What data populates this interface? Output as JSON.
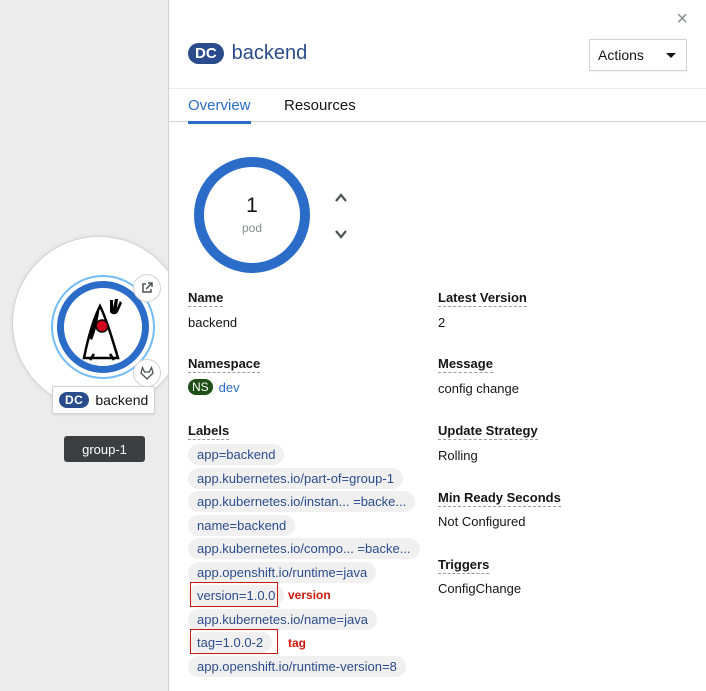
{
  "topology": {
    "node": {
      "kind_badge": "DC",
      "name": "backend"
    },
    "group_label": "group-1"
  },
  "panel": {
    "close_glyph": "×",
    "kind_badge": "DC",
    "title": "backend",
    "actions_label": "Actions",
    "tabs": [
      {
        "label": "Overview",
        "active": true
      },
      {
        "label": "Resources",
        "active": false
      }
    ],
    "pod_count": "1",
    "pod_unit": "pod",
    "left_fields": {
      "name": {
        "label": "Name",
        "value": "backend"
      },
      "namespace": {
        "label": "Namespace",
        "badge": "NS",
        "value": "dev"
      },
      "labels": {
        "label": "Labels"
      }
    },
    "right_fields": {
      "latest_version": {
        "label": "Latest Version",
        "value": "2"
      },
      "message": {
        "label": "Message",
        "value": "config change"
      },
      "update_strategy": {
        "label": "Update Strategy",
        "value": "Rolling"
      },
      "min_ready": {
        "label": "Min Ready Seconds",
        "value": "Not Configured"
      },
      "triggers": {
        "label": "Triggers",
        "value": "ConfigChange"
      }
    },
    "labels": [
      "app=backend",
      "app.kubernetes.io/part-of=group-1",
      "app.kubernetes.io/instan... =backe...",
      "name=backend",
      "app.kubernetes.io/compo... =backe...",
      "app.openshift.io/runtime=java",
      "version=1.0.0",
      "app.kubernetes.io/name=java",
      "tag=1.0.0-2",
      "app.openshift.io/runtime-version=8"
    ],
    "annotations": {
      "version": "version",
      "tag": "tag"
    }
  },
  "colors": {
    "accent": "#2b6cc9",
    "badge_dc": "#2b4c8c",
    "badge_ns": "#1e4f18",
    "highlight": "#c9190b"
  }
}
